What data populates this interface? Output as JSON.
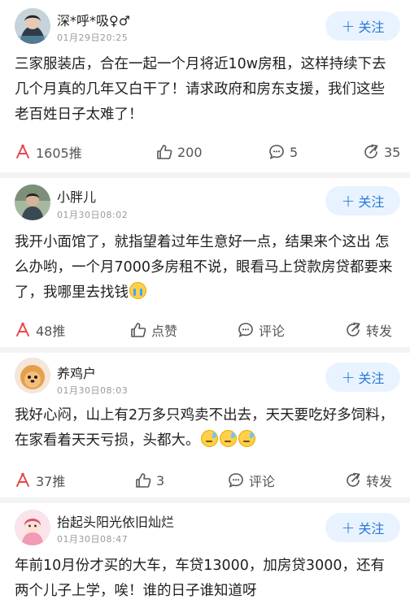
{
  "follow_label": "关注",
  "posts": [
    {
      "name": "深*呼*吸♀♂",
      "time": "01月29日20:25",
      "content": "三家服装店，合在一起一个月将近10w房租，这样持续下去几个月真的几年又白干了！请求政府和房东支援，我们这些老百姓日子太难了！",
      "share": "1605推",
      "like": "200",
      "comment": "5",
      "forward": "35"
    },
    {
      "name": "小胖儿",
      "time": "01月30日08:02",
      "content": "我开小面馆了，就指望着过年生意好一点，结果来个这出 怎么办哟，一个月7000多房租不说，眼看马上贷款房贷都要来了，我哪里去找钱",
      "share": "48推",
      "like": "点赞",
      "comment": "评论",
      "forward": "转发"
    },
    {
      "name": "养鸡户",
      "time": "01月30日08:03",
      "content": "我好心闷，山上有2万多只鸡卖不出去，天天要吃好多饲料，在家看着天天亏损，头都大。",
      "share": "37推",
      "like": "3",
      "comment": "评论",
      "forward": "转发"
    },
    {
      "name": "抬起头阳光依旧灿烂",
      "time": "01月30日08:47",
      "content": "年前10月份才买的大车，车贷13000，加房贷3000，还有两个儿子上学，唉！谁的日子谁知道呀"
    }
  ],
  "colors": {
    "accent": "#2b78d8",
    "follow_bg": "#e9f3ff",
    "share_icon": "#e5484d",
    "muted": "#9a9a9a"
  },
  "icons": [
    "share-icon",
    "thumbs-up-icon",
    "comment-icon",
    "forward-icon",
    "plus-icon",
    "crying-emoji",
    "sweat-emoji"
  ]
}
